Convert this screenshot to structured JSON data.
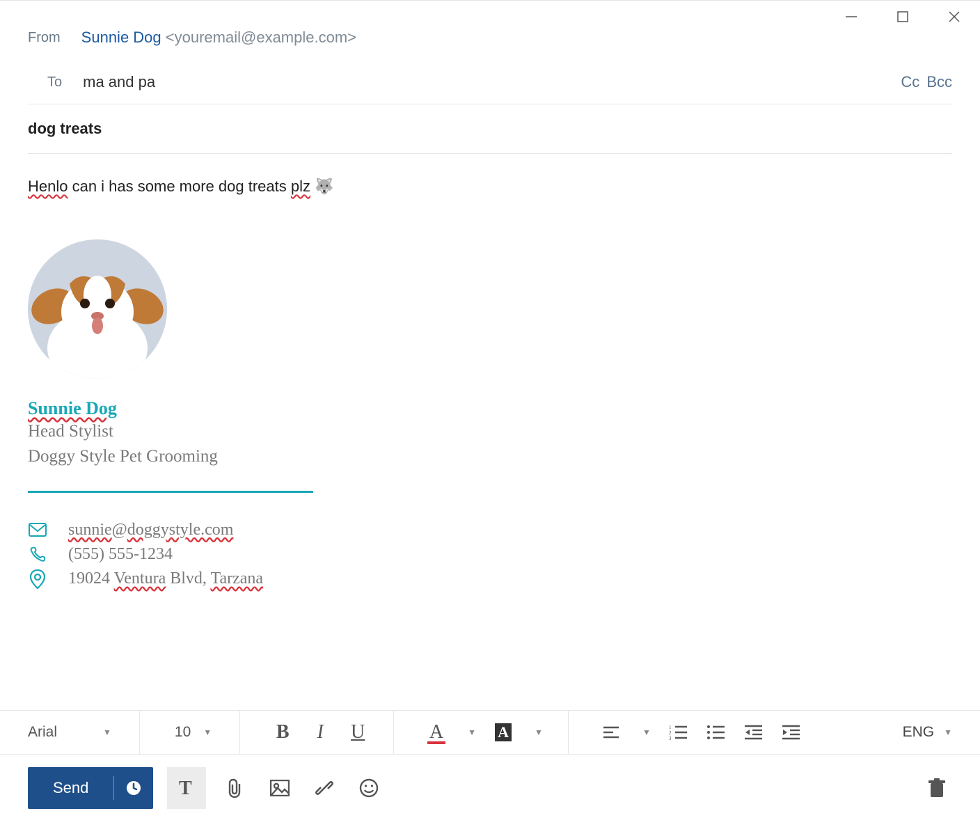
{
  "header": {
    "from_label": "From",
    "from_name": "Sunnie Dog",
    "from_email": "<youremail@example.com>",
    "to_label": "To",
    "to_value": "ma and pa",
    "cc_label": "Cc",
    "bcc_label": "Bcc",
    "subject": "dog treats"
  },
  "body": {
    "word1": "Henlo",
    "middle": " can i has some more dog treats ",
    "word2": "plz",
    "emoji": " 🐺"
  },
  "signature": {
    "name": "Sunnie Dog",
    "title": "Head Stylist",
    "company": "Doggy Style Pet Grooming",
    "email_pre": "sunnie",
    "email_at": "@",
    "email_dom": "doggystyle.com",
    "phone": "(555) 555-1234",
    "address_num": "19024 ",
    "address_st": "Ventura",
    "address_mid": " Blvd, ",
    "address_city": "Tarzana"
  },
  "formatbar": {
    "font_family": "Arial",
    "font_size": "10",
    "lang": "ENG"
  },
  "actions": {
    "send": "Send"
  }
}
